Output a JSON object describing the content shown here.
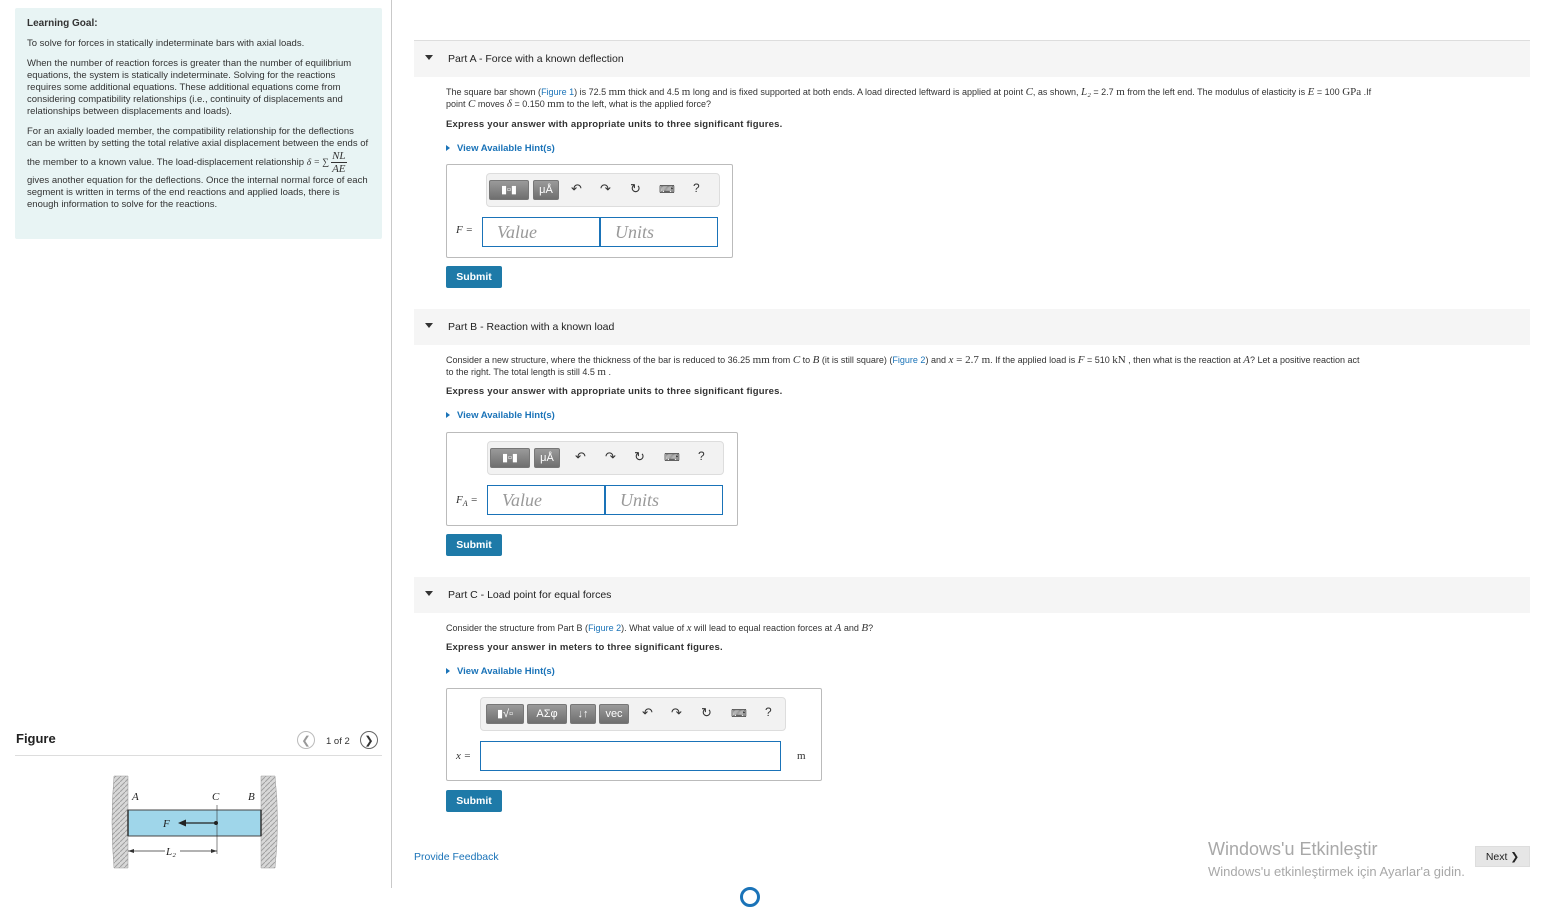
{
  "learning": {
    "title": "Learning Goal:",
    "p1": "To solve for forces in statically indeterminate bars with axial loads.",
    "p2": "When the number of reaction forces is greater than the number of equilibrium equations, the system is statically indeterminate. Solving for the reactions requires some additional equations. These additional equations come from considering compatibility relationships (i.e., continuity of displacements and relationships between displacements and loads).",
    "p3a": "For an axially loaded member, the compatibility relationship for the deflections can be written by setting the total relative axial displacement between the ends of the member to a known value. The load-displacement relationship ",
    "p3_formula_lhs": "δ = ∑",
    "p3_frac_num": "NL",
    "p3_frac_den": "AE",
    "p3b": " gives another equation for the deflections. Once the internal normal force of each segment is written in terms of the end reactions and applied loads, there is enough information to solve for the reactions."
  },
  "figure": {
    "title": "Figure",
    "counter": "1 of 2",
    "labels": {
      "A": "A",
      "C": "C",
      "B": "B",
      "F": "F",
      "L2": "L₂"
    }
  },
  "partA": {
    "title_bold": "Part A",
    "title_rest": " - Force with a known deflection",
    "q_line1": "The square bar shown (",
    "q_fig": "Figure 1",
    "q_line1b": ") is 72.5 ",
    "q_mm": "mm",
    "q_line1c": " thick and 4.5 ",
    "q_m": "m",
    "q_line1d": " long and is fixed supported at both ends. A load directed leftward is applied at point ",
    "q_C": "C",
    "q_line1e": ", as shown, ",
    "q_L2": "L₂",
    "q_line1f": " = 2.7 ",
    "q_m2": "m",
    "q_line1g": " from the left end. The modulus of elasticity is ",
    "q_E": "E",
    "q_line1h": " = 100 ",
    "q_GPa": "GPa",
    "q_line1i": " .If",
    "q_line2a": "point ",
    "q_C2": "C",
    "q_line2b": " moves ",
    "q_delta": "δ",
    "q_line2c": " = 0.150 ",
    "q_mm2": "mm",
    "q_line2d": " to the left, what is the applied force?",
    "express": "Express your answer with appropriate units to three significant figures.",
    "hint": "View Available Hint(s)",
    "var": "F =",
    "value_placeholder": "Value",
    "units_placeholder": "Units",
    "submit": "Submit"
  },
  "partB": {
    "title_bold": "Part B",
    "title_rest": " - Reaction with a known load",
    "q_a": "Consider a new structure, where the thickness of the bar is reduced to 36.25 ",
    "q_mm": "mm",
    "q_b": " from ",
    "q_C": "C",
    "q_c": " to ",
    "q_B": "B",
    "q_d": " (it is still square) (",
    "q_fig": "Figure 2",
    "q_e": ") and ",
    "q_x": "x",
    "q_f": " = 2.7 ",
    "q_m": "m",
    "q_g": ". If the applied load is ",
    "q_F": "F",
    "q_h": " = 510 ",
    "q_kN": "kN",
    "q_i": " , then what is the reaction at ",
    "q_A": "A",
    "q_j": "? Let a positive reaction act",
    "q_line2": "to the right. The total length is still 4.5 ",
    "q_m2": "m",
    "q_line2b": " .",
    "express": "Express your answer with appropriate units to three significant figures.",
    "hint": "View Available Hint(s)",
    "var": "F",
    "var_sub": "A",
    "var_eq": " =",
    "value_placeholder": "Value",
    "units_placeholder": "Units",
    "submit": "Submit"
  },
  "partC": {
    "title_bold": "Part C",
    "title_rest": " - Load point for equal forces",
    "q_a": "Consider the structure from Part B (",
    "q_fig": "Figure 2",
    "q_b": "). What value of ",
    "q_x": "x",
    "q_c": " will lead to equal reaction forces at ",
    "q_A": "A",
    "q_d": " and ",
    "q_B": "B",
    "q_e": "?",
    "express": "Express your answer in meters to three significant figures.",
    "hint": "View Available Hint(s)",
    "var": "x =",
    "unit": "m",
    "submit": "Submit"
  },
  "toolbar": {
    "mu": "μÅ",
    "sigma": "ΑΣφ",
    "arrows": "↓↑",
    "vec": "vec",
    "help": "?"
  },
  "footer": {
    "feedback": "Provide Feedback",
    "win1": "Windows'u Etkinleştir",
    "win2": "Windows'u etkinleştirmek için Ayarlar'a gidin.",
    "next": "Next"
  }
}
